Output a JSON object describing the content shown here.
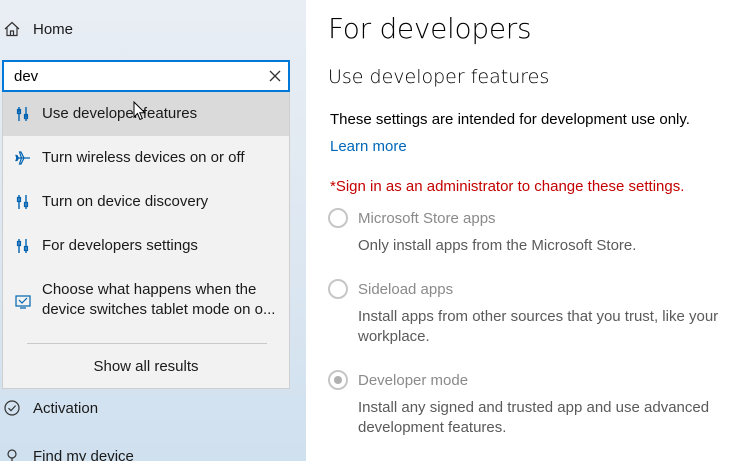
{
  "nav": {
    "home_label": "Home",
    "activation_label": "Activation",
    "find_device_label": "Find my device"
  },
  "search": {
    "value": "dev"
  },
  "results": {
    "items": [
      {
        "icon": "developer-tools-icon",
        "label": "Use developer features"
      },
      {
        "icon": "airplane-icon",
        "label": "Turn wireless devices on or off"
      },
      {
        "icon": "developer-tools-icon",
        "label": "Turn on device discovery"
      },
      {
        "icon": "developer-tools-icon",
        "label": "For developers settings"
      },
      {
        "icon": "tablet-mode-icon",
        "label_line1": "Choose what happens when the",
        "label_line2": "device switches tablet mode on o..."
      }
    ],
    "show_all": "Show all results"
  },
  "content": {
    "title": "For developers",
    "section": "Use developer features",
    "description": "These settings are intended for development use only.",
    "learn_more": "Learn more",
    "admin_warning": "*Sign in as an administrator to change these settings.",
    "options": [
      {
        "label": "Microsoft Store apps",
        "desc": "Only install apps from the Microsoft Store.",
        "selected": false
      },
      {
        "label": "Sideload apps",
        "desc": "Install apps from other sources that you trust, like your workplace.",
        "selected": false
      },
      {
        "label": "Developer mode",
        "desc": "Install any signed and trusted app and use advanced development features.",
        "selected": true
      }
    ]
  },
  "colors": {
    "accent": "#0078d7",
    "link": "#0067b8",
    "warning": "#c40000"
  }
}
